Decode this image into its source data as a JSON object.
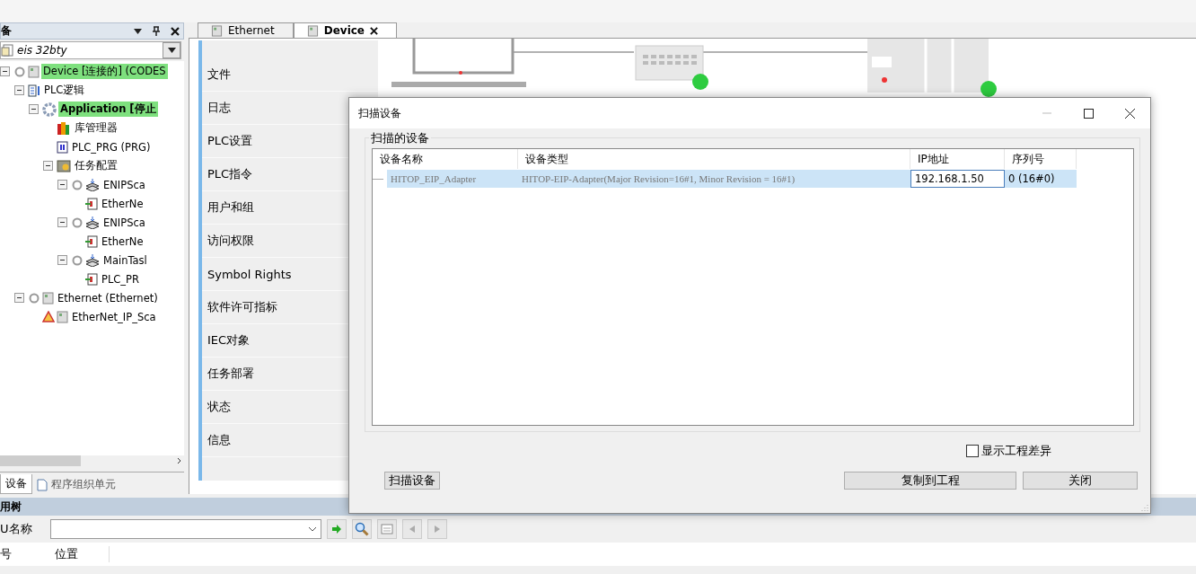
{
  "devices_panel": {
    "title": "备",
    "project": "eis 32bty",
    "tree": [
      {
        "label": "Device [连接的] (CODES",
        "kind": "device",
        "highlighted": true,
        "active": false,
        "expanded": true,
        "children": [
          {
            "label": "PLC逻辑",
            "kind": "logic",
            "highlighted": false,
            "active": false,
            "expanded": true,
            "children": [
              {
                "label": "Application [停止",
                "kind": "application",
                "highlighted": true,
                "active": true,
                "expanded": true,
                "children": [
                  {
                    "label": "库管理器",
                    "kind": "library",
                    "highlighted": false,
                    "active": false
                  },
                  {
                    "label": "PLC_PRG (PRG)",
                    "kind": "program",
                    "highlighted": false,
                    "active": false
                  },
                  {
                    "label": "任务配置",
                    "kind": "task-config",
                    "highlighted": false,
                    "active": false,
                    "expanded": true,
                    "children": [
                      {
                        "label": "ENIPSca",
                        "kind": "task",
                        "highlighted": false,
                        "active": false,
                        "expanded": true,
                        "children": [
                          {
                            "label": "EtherNe",
                            "kind": "call",
                            "highlighted": false,
                            "active": false
                          }
                        ]
                      },
                      {
                        "label": "ENIPSca",
                        "kind": "task",
                        "highlighted": false,
                        "active": false,
                        "expanded": true,
                        "children": [
                          {
                            "label": "EtherNe",
                            "kind": "call",
                            "highlighted": false,
                            "active": false
                          }
                        ]
                      },
                      {
                        "label": "MainTasl",
                        "kind": "task",
                        "highlighted": false,
                        "active": false,
                        "expanded": true,
                        "children": [
                          {
                            "label": "PLC_PR",
                            "kind": "call",
                            "highlighted": false,
                            "active": false
                          }
                        ]
                      }
                    ]
                  }
                ]
              }
            ]
          },
          {
            "label": "Ethernet (Ethernet)",
            "kind": "device",
            "highlighted": false,
            "active": false,
            "expanded": true,
            "children": [
              {
                "label": "EtherNet_IP_Sca",
                "kind": "device-warning",
                "highlighted": false,
                "active": false
              }
            ]
          }
        ]
      }
    ],
    "tabs": [
      {
        "label": "设备",
        "selected": true
      },
      {
        "label": "程序组织单元",
        "selected": false
      }
    ]
  },
  "editor_tabs": [
    {
      "label": "Ethernet",
      "selected": false
    },
    {
      "label": "Device",
      "selected": true
    }
  ],
  "device_menu": [
    "文件",
    "日志",
    "PLC设置",
    "PLC指令",
    "用户和组",
    "访问权限",
    "Symbol Rights",
    "软件许可指标",
    "IEC对象",
    "任务部署",
    "状态",
    "信息"
  ],
  "bottom_panel": {
    "title": "用树",
    "filter_label": "U名称",
    "columns": [
      "号",
      "位置"
    ]
  },
  "scan_dialog": {
    "title": "扫描设备",
    "group": "扫描的设备",
    "columns": [
      "设备名称",
      "设备类型",
      "IP地址",
      "序列号"
    ],
    "rows": [
      {
        "selected": true,
        "cells": [
          {
            "text": "HITOP_EIP_Adapter",
            "dimmed": true,
            "focused": false
          },
          {
            "text": "HITOP-EIP-Adapter(Major Revision=16#1, Minor Revision = 16#1)",
            "dimmed": true,
            "focused": false
          },
          {
            "text": "192.168.1.50",
            "dimmed": false,
            "focused": true
          },
          {
            "text": "0 (16#0)",
            "dimmed": false,
            "focused": false
          }
        ]
      }
    ],
    "show_differences": {
      "label": "显示工程差异",
      "checked": false
    },
    "buttons": [
      {
        "label": "扫描设备",
        "kind": "left"
      },
      {
        "label": "复制到工程",
        "kind": "right"
      },
      {
        "label": "关闭",
        "kind": "right"
      }
    ]
  }
}
